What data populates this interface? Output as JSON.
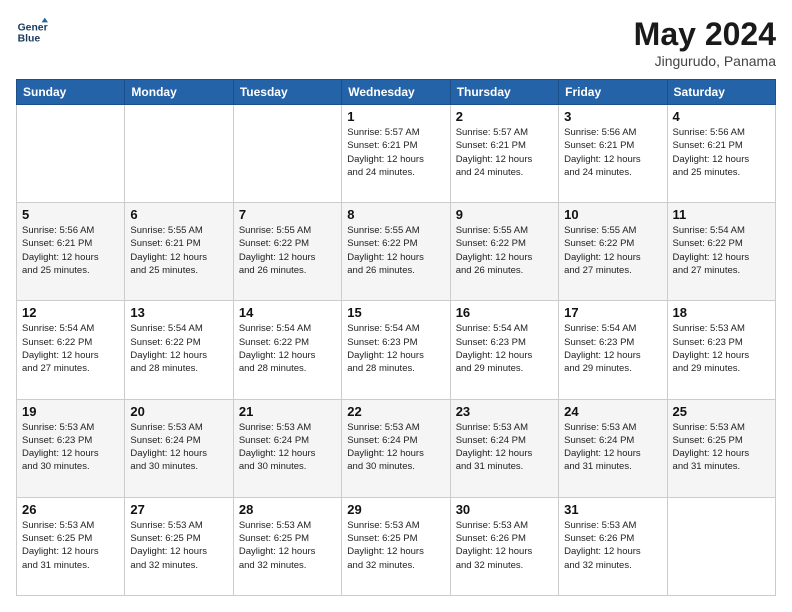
{
  "logo": {
    "line1": "General",
    "line2": "Blue"
  },
  "title": "May 2024",
  "location": "Jingurudo, Panama",
  "days_of_week": [
    "Sunday",
    "Monday",
    "Tuesday",
    "Wednesday",
    "Thursday",
    "Friday",
    "Saturday"
  ],
  "weeks": [
    [
      {
        "day": "",
        "info": ""
      },
      {
        "day": "",
        "info": ""
      },
      {
        "day": "",
        "info": ""
      },
      {
        "day": "1",
        "info": "Sunrise: 5:57 AM\nSunset: 6:21 PM\nDaylight: 12 hours\nand 24 minutes."
      },
      {
        "day": "2",
        "info": "Sunrise: 5:57 AM\nSunset: 6:21 PM\nDaylight: 12 hours\nand 24 minutes."
      },
      {
        "day": "3",
        "info": "Sunrise: 5:56 AM\nSunset: 6:21 PM\nDaylight: 12 hours\nand 24 minutes."
      },
      {
        "day": "4",
        "info": "Sunrise: 5:56 AM\nSunset: 6:21 PM\nDaylight: 12 hours\nand 25 minutes."
      }
    ],
    [
      {
        "day": "5",
        "info": "Sunrise: 5:56 AM\nSunset: 6:21 PM\nDaylight: 12 hours\nand 25 minutes."
      },
      {
        "day": "6",
        "info": "Sunrise: 5:55 AM\nSunset: 6:21 PM\nDaylight: 12 hours\nand 25 minutes."
      },
      {
        "day": "7",
        "info": "Sunrise: 5:55 AM\nSunset: 6:22 PM\nDaylight: 12 hours\nand 26 minutes."
      },
      {
        "day": "8",
        "info": "Sunrise: 5:55 AM\nSunset: 6:22 PM\nDaylight: 12 hours\nand 26 minutes."
      },
      {
        "day": "9",
        "info": "Sunrise: 5:55 AM\nSunset: 6:22 PM\nDaylight: 12 hours\nand 26 minutes."
      },
      {
        "day": "10",
        "info": "Sunrise: 5:55 AM\nSunset: 6:22 PM\nDaylight: 12 hours\nand 27 minutes."
      },
      {
        "day": "11",
        "info": "Sunrise: 5:54 AM\nSunset: 6:22 PM\nDaylight: 12 hours\nand 27 minutes."
      }
    ],
    [
      {
        "day": "12",
        "info": "Sunrise: 5:54 AM\nSunset: 6:22 PM\nDaylight: 12 hours\nand 27 minutes."
      },
      {
        "day": "13",
        "info": "Sunrise: 5:54 AM\nSunset: 6:22 PM\nDaylight: 12 hours\nand 28 minutes."
      },
      {
        "day": "14",
        "info": "Sunrise: 5:54 AM\nSunset: 6:22 PM\nDaylight: 12 hours\nand 28 minutes."
      },
      {
        "day": "15",
        "info": "Sunrise: 5:54 AM\nSunset: 6:23 PM\nDaylight: 12 hours\nand 28 minutes."
      },
      {
        "day": "16",
        "info": "Sunrise: 5:54 AM\nSunset: 6:23 PM\nDaylight: 12 hours\nand 29 minutes."
      },
      {
        "day": "17",
        "info": "Sunrise: 5:54 AM\nSunset: 6:23 PM\nDaylight: 12 hours\nand 29 minutes."
      },
      {
        "day": "18",
        "info": "Sunrise: 5:53 AM\nSunset: 6:23 PM\nDaylight: 12 hours\nand 29 minutes."
      }
    ],
    [
      {
        "day": "19",
        "info": "Sunrise: 5:53 AM\nSunset: 6:23 PM\nDaylight: 12 hours\nand 30 minutes."
      },
      {
        "day": "20",
        "info": "Sunrise: 5:53 AM\nSunset: 6:24 PM\nDaylight: 12 hours\nand 30 minutes."
      },
      {
        "day": "21",
        "info": "Sunrise: 5:53 AM\nSunset: 6:24 PM\nDaylight: 12 hours\nand 30 minutes."
      },
      {
        "day": "22",
        "info": "Sunrise: 5:53 AM\nSunset: 6:24 PM\nDaylight: 12 hours\nand 30 minutes."
      },
      {
        "day": "23",
        "info": "Sunrise: 5:53 AM\nSunset: 6:24 PM\nDaylight: 12 hours\nand 31 minutes."
      },
      {
        "day": "24",
        "info": "Sunrise: 5:53 AM\nSunset: 6:24 PM\nDaylight: 12 hours\nand 31 minutes."
      },
      {
        "day": "25",
        "info": "Sunrise: 5:53 AM\nSunset: 6:25 PM\nDaylight: 12 hours\nand 31 minutes."
      }
    ],
    [
      {
        "day": "26",
        "info": "Sunrise: 5:53 AM\nSunset: 6:25 PM\nDaylight: 12 hours\nand 31 minutes."
      },
      {
        "day": "27",
        "info": "Sunrise: 5:53 AM\nSunset: 6:25 PM\nDaylight: 12 hours\nand 32 minutes."
      },
      {
        "day": "28",
        "info": "Sunrise: 5:53 AM\nSunset: 6:25 PM\nDaylight: 12 hours\nand 32 minutes."
      },
      {
        "day": "29",
        "info": "Sunrise: 5:53 AM\nSunset: 6:25 PM\nDaylight: 12 hours\nand 32 minutes."
      },
      {
        "day": "30",
        "info": "Sunrise: 5:53 AM\nSunset: 6:26 PM\nDaylight: 12 hours\nand 32 minutes."
      },
      {
        "day": "31",
        "info": "Sunrise: 5:53 AM\nSunset: 6:26 PM\nDaylight: 12 hours\nand 32 minutes."
      },
      {
        "day": "",
        "info": ""
      }
    ]
  ]
}
